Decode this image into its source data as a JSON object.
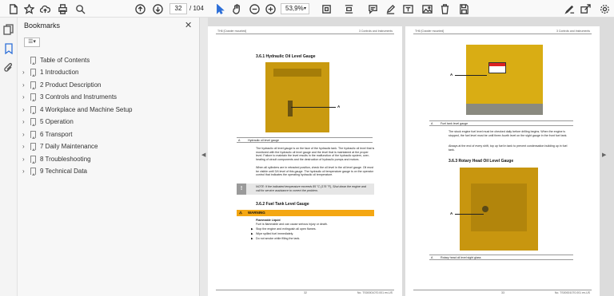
{
  "toolbar": {
    "page_current": "32",
    "page_total": "/ 104",
    "zoom": "53,9%"
  },
  "bookmarks": {
    "title": "Bookmarks",
    "items": [
      {
        "label": "Table of Contents",
        "expandable": false
      },
      {
        "label": "1 Introduction",
        "expandable": true
      },
      {
        "label": "2 Product Description",
        "expandable": true
      },
      {
        "label": "3 Controls and Instruments",
        "expandable": true
      },
      {
        "label": "4 Workplace and Machine Setup",
        "expandable": true
      },
      {
        "label": "5 Operation",
        "expandable": true
      },
      {
        "label": "6 Transport",
        "expandable": true
      },
      {
        "label": "7 Daily Maintenance",
        "expandable": true
      },
      {
        "label": "8 Troubleshooting",
        "expandable": true
      },
      {
        "label": "9 Technical Data",
        "expandable": true
      }
    ]
  },
  "page_left": {
    "header_left": "TH6 [Crawler mounted]",
    "header_right": "3 Controls and Instruments",
    "section1_title": "3.6.1 Hydraulic Oil Level Gauge",
    "callout": "A",
    "caption_key": "A",
    "caption_text": "Hydraulic oil level gauge",
    "body1": "The hydraulic oil level gauge is on the face of the hydraulic tank. The hydraulic oil level that is monitored with the hydraulic oil level gauge and the level that is maintained at the proper level. Failure to maintain the level results in the malfunction of the hydraulic system, over-heating of circuit components and the destruction of hydraulic pumps and motors.",
    "body2": "When all cylinders are in retracted position, check the oil level in the oil level gauge. Oil must be visible until 3/4 level of this gauge. The hydraulic oil temperature gauge is on the operator control that indicates the operating hydraulic oil temperature.",
    "note_text": "NOTE: If the indicated temperature exceeds 85 °C (176 °F), Shut down the engine and call for service assistance to correct the problem.",
    "section2_title": "3.6.2 Fuel Tank Level Gauge",
    "warning_title": "WARNING",
    "warning_subtitle": "Flammable Liquid",
    "warning_lead": "Fuel is flammable and can cause serious injury or death.",
    "warning_items": [
      "Stop the engine and extinguish all open flames.",
      "Wipe spilled fuel immediately.",
      "Do not smoke while filling the tank."
    ],
    "footer_left": "32",
    "footer_right": "No. TS00001070.001 en-US"
  },
  "page_right": {
    "header_left": "TH6 [Crawler mounted]",
    "header_right": "3 Controls and Instruments",
    "callout1": "A",
    "caption1_key": "A",
    "caption1_text": "Fuel tank level gauge",
    "body1": "The stock engine fuel level must be checked daily before drilling begins. When the engine is stopped, the fuel level must be until three-fourth level on the sight gauge in the front fuel tank.",
    "body2": "Always at the end of every shift, top up fuel in tank to prevent condensation building up in fuel tank.",
    "section_title": "3.6.3 Rotary Head Oil Level Gauge",
    "callout2": "A",
    "caption2_key": "A",
    "caption2_text": "Rotary head oil level sight glass",
    "footer_left": "33",
    "footer_right": "No. TS00001070.001 en-US"
  },
  "colors": {
    "machine_yellow": "#c99a10",
    "warning_orange": "#f4a713",
    "toolbar_bg": "#f9f9f9",
    "viewer_bg": "#dcdcdc"
  }
}
